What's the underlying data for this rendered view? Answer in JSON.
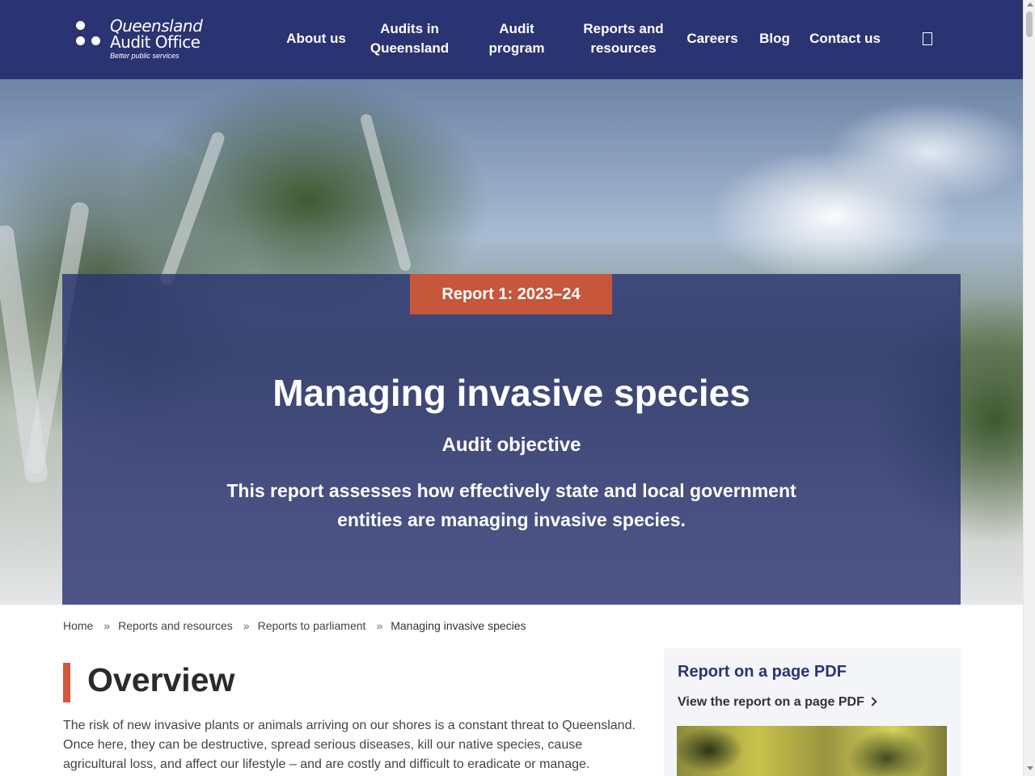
{
  "header": {
    "logo": {
      "line1": "Queensland",
      "line2": "Audit Office",
      "tagline": "Better public services"
    },
    "nav": [
      {
        "line1": "About us",
        "line2": ""
      },
      {
        "line1": "Audits in",
        "line2": "Queensland"
      },
      {
        "line1": "Audit",
        "line2": "program"
      },
      {
        "line1": "Reports and",
        "line2": "resources"
      },
      {
        "line1": "Careers",
        "line2": ""
      },
      {
        "line1": "Blog",
        "line2": ""
      },
      {
        "line1": "Contact us",
        "line2": ""
      }
    ],
    "search_icon": "search-icon"
  },
  "hero": {
    "tag": "Report 1: 2023–24",
    "title": "Managing invasive species",
    "subtitle": "Audit objective",
    "description": "This report assesses how effectively state and local government entities are managing invasive species."
  },
  "breadcrumb": {
    "items": [
      "Home",
      "Reports and resources",
      "Reports to parliament"
    ],
    "current": "Managing invasive species",
    "separator": "»"
  },
  "overview": {
    "title": "Overview",
    "text": "The risk of new invasive plants or animals arriving on our shores is a constant threat to Queensland. Once here, they can be destructive, spread serious diseases, kill our native species, cause agricultural loss, and affect our lifestyle – and are costly and difficult to eradicate or manage."
  },
  "sidebar": {
    "title": "Report on a page PDF",
    "link": "View the report on a page PDF"
  },
  "colors": {
    "header_bg": "#2b3472",
    "accent": "#c6573b",
    "overview_bar": "#d4573b"
  }
}
